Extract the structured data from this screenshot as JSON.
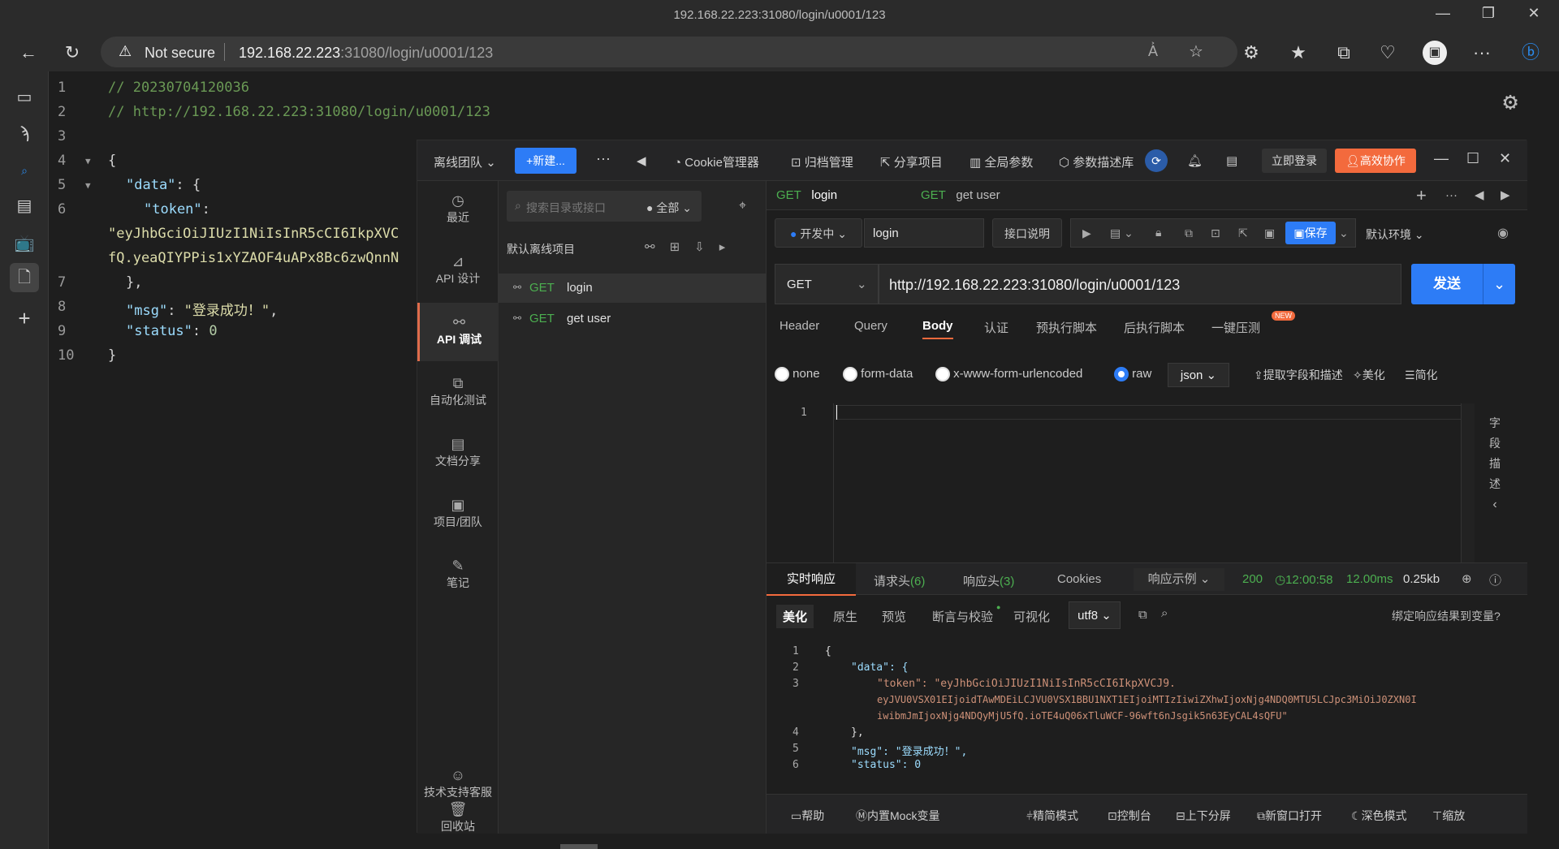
{
  "browser": {
    "tab_title": "192.168.22.223:31080/login/u0001/123",
    "not_secure": "Not secure",
    "url_host": "192.168.22.223",
    "url_rest": ":31080/login/u0001/123"
  },
  "viewer": {
    "lines": [
      "1",
      "2",
      "3",
      "4",
      "5",
      "6",
      "",
      "7",
      "8",
      "9",
      "10"
    ],
    "comment1": "// 20230704120036",
    "comment2": "// http://192.168.22.223:31080/login/u0001/123",
    "brace_open": "{",
    "data_key": "\"data\"",
    "token_key": "\"token\"",
    "token_line1": "\"eyJhbGciOiJIUzI1NiIsInR5cCI6IkpXVC",
    "token_line2": "fQ.yeaQIYPPis1xYZAOF4uAPx8Bc6zwQnnN",
    "close_inner": "},",
    "msg_key": "\"msg\"",
    "msg_val": "\"登录成功！\"",
    "status_key": "\"status\"",
    "status_val": "0",
    "brace_close": "}"
  },
  "apipost": {
    "team": "离线团队",
    "new_btn": "+新建...",
    "more": "···",
    "cookie": "Cookie管理器",
    "archive": "归档管理",
    "share": "分享项目",
    "global_params": "全局参数",
    "param_lib": "参数描述库",
    "login_now": "立即登录",
    "collab": "高效协作",
    "nav": [
      {
        "label": "最近",
        "icon": "clock-icon"
      },
      {
        "label": "API 设计",
        "icon": "design-icon"
      },
      {
        "label": "API 调试",
        "icon": "debug-icon"
      },
      {
        "label": "自动化测试",
        "icon": "auto-test-icon"
      },
      {
        "label": "文档分享",
        "icon": "doc-share-icon"
      },
      {
        "label": "项目/团队",
        "icon": "project-icon"
      },
      {
        "label": "笔记",
        "icon": "note-icon"
      }
    ],
    "support": "技术支持客服",
    "recycle": "回收站",
    "search_placeholder": "搜索目录或接口",
    "filter_all": "全部",
    "project_name": "默认离线项目",
    "tree": [
      {
        "method": "GET",
        "name": "login"
      },
      {
        "method": "GET",
        "name": "get user"
      }
    ],
    "tabs": [
      {
        "method": "GET",
        "name": "login"
      },
      {
        "method": "GET",
        "name": "get user"
      }
    ],
    "status_dev": "开发中",
    "api_name": "login",
    "api_desc_btn": "接口说明",
    "save_btn": "保存",
    "env": "默认环境",
    "method": "GET",
    "url": "http://192.168.22.223:31080/login/u0001/123",
    "send": "发送",
    "req_tabs": [
      "Header",
      "Query",
      "Body",
      "认证",
      "预执行脚本",
      "后执行脚本",
      "一键压测"
    ],
    "new_badge": "NEW",
    "body_types": [
      "none",
      "form-data",
      "x-www-form-urlencoded",
      "raw"
    ],
    "raw_type": "json",
    "extract_fields": "提取字段和描述",
    "beautify": "美化",
    "simplify": "简化",
    "editor_line": "1",
    "field_desc": [
      "字",
      "段",
      "描",
      "述"
    ],
    "resp_tabs": [
      {
        "label": "实时响应",
        "count": ""
      },
      {
        "label": "请求头",
        "count": "(6)"
      },
      {
        "label": "响应头",
        "count": "(3)"
      },
      {
        "label": "Cookies",
        "count": ""
      }
    ],
    "resp_example": "响应示例",
    "resp_status": "200",
    "resp_time": "12:00:58",
    "resp_ms": "12.00ms",
    "resp_size": "0.25kb",
    "view_tabs": [
      "美化",
      "原生",
      "预览",
      "断言与校验",
      "可视化"
    ],
    "encoding": "utf8",
    "bind_resp": "绑定响应结果到变量?",
    "resp_lines": [
      "1",
      "2",
      "3",
      "",
      "",
      "4",
      "5",
      "6"
    ],
    "resp_code": [
      "{",
      "\"data\": {",
      "\"token\": \"eyJhbGciOiJIUzI1NiIsInR5cCI6IkpXVCJ9.",
      "eyJVU0VSX01EIjoidTAwMDEiLCJVU0VSX1BBU1NXT1EIjoiMTIzIiwiZXhwIjoxNjg4NDQ0MTU5LCJpc3MiOiJ0ZXN0I",
      "iwibmJmIjoxNjg4NDQyMjU5fQ.ioTE4uQ06xTluWCF-96wft6nJsgik5n63EyCAL4sQFU\"",
      "},",
      "\"msg\": \"登录成功！\",",
      "\"status\": 0"
    ],
    "bottom": [
      "帮助",
      "内置Mock变量",
      "精简模式",
      "控制台",
      "上下分屏",
      "新窗口打开",
      "深色模式",
      "缩放"
    ]
  }
}
